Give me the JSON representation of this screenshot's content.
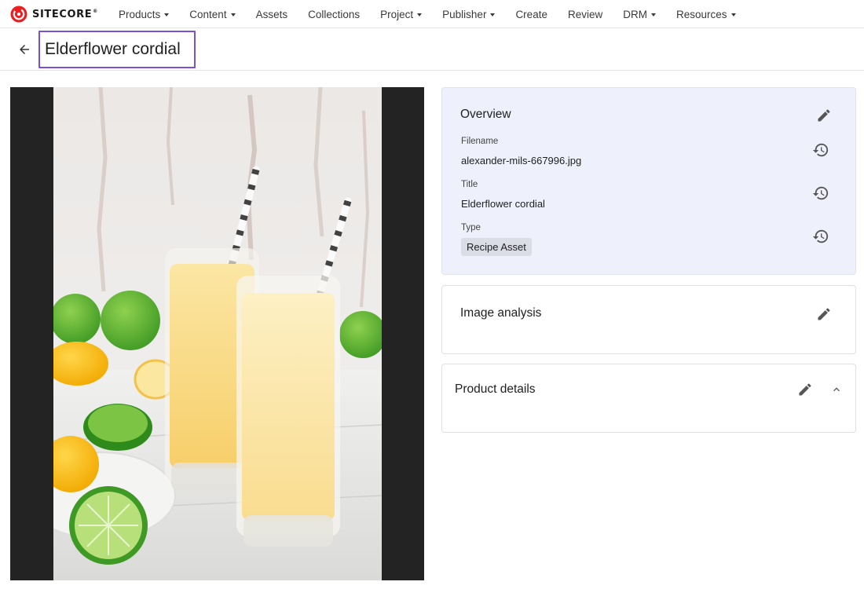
{
  "brand": {
    "name": "SITECORE",
    "accent_color": "#eb1f1f"
  },
  "nav": {
    "items": [
      {
        "label": "Products",
        "has_dropdown": true
      },
      {
        "label": "Content",
        "has_dropdown": true
      },
      {
        "label": "Assets",
        "has_dropdown": false
      },
      {
        "label": "Collections",
        "has_dropdown": false
      },
      {
        "label": "Project",
        "has_dropdown": true
      },
      {
        "label": "Publisher",
        "has_dropdown": true
      },
      {
        "label": "Create",
        "has_dropdown": false
      },
      {
        "label": "Review",
        "has_dropdown": false
      },
      {
        "label": "DRM",
        "has_dropdown": true
      },
      {
        "label": "Resources",
        "has_dropdown": true
      }
    ]
  },
  "page": {
    "title": "Elderflower cordial",
    "highlight_color": "#7b4fd6",
    "back_icon": "arrow-left-icon"
  },
  "overview": {
    "title": "Overview",
    "background_color": "#eef0fb",
    "fields": [
      {
        "label": "Filename",
        "value": "alexander-mils-667996.jpg"
      },
      {
        "label": "Title",
        "value": "Elderflower cordial"
      },
      {
        "label": "Type",
        "value": "Recipe Asset"
      }
    ],
    "edit_icon": "pencil-icon",
    "history_icon": "history-icon"
  },
  "image_analysis": {
    "title": "Image analysis",
    "edit_icon": "pencil-icon"
  },
  "product_details": {
    "title": "Product details",
    "edit_icon": "pencil-icon",
    "collapse_icon": "chevron-up-icon"
  }
}
